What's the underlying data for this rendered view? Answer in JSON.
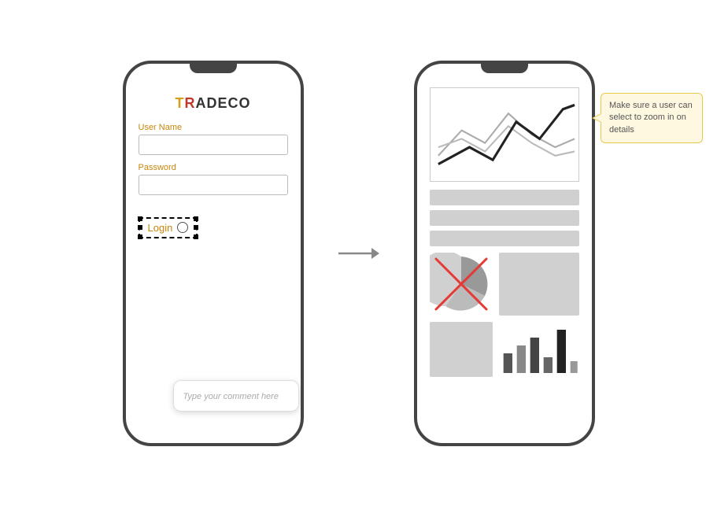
{
  "leftPhone": {
    "title": "TRADECO",
    "fields": [
      {
        "label": "User Name",
        "placeholder": ""
      },
      {
        "label": "Password",
        "placeholder": ""
      }
    ],
    "loginButton": "Login",
    "commentPlaceholder": "Type your comment here"
  },
  "rightPhone": {
    "barRows": 3,
    "annotation": "Make sure a user can select to zoom in on details"
  },
  "arrow": "→"
}
